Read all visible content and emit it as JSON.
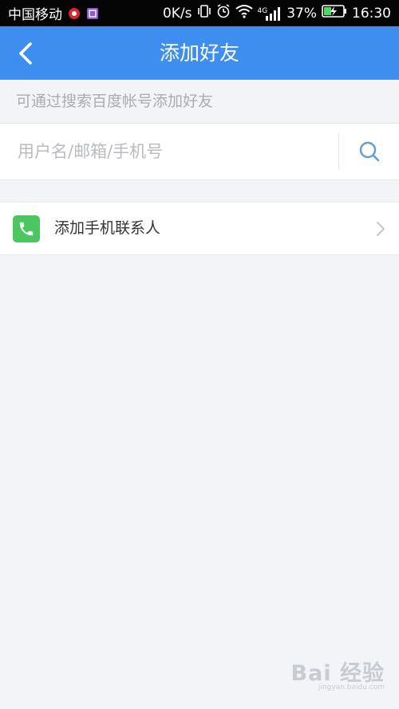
{
  "status_bar": {
    "carrier": "中国移动",
    "speed": "0K/s",
    "network": "4G",
    "battery": "37%",
    "time": "16:30"
  },
  "header": {
    "title": "添加好友"
  },
  "hint": "可通过搜索百度帐号添加好友",
  "search": {
    "placeholder": "用户名/邮箱/手机号",
    "value": ""
  },
  "contacts_row": {
    "label": "添加手机联系人"
  },
  "watermark": {
    "logo": "Bai 经验",
    "url": "jingyan.baidu.com"
  },
  "colors": {
    "header_bg": "#3d8eef",
    "phone_icon_bg": "#4cc760",
    "page_bg": "#f2f4f7"
  },
  "icons": [
    "back-arrow-icon",
    "search-icon",
    "phone-icon",
    "chevron-right-icon",
    "wifi-icon",
    "signal-icon",
    "battery-icon",
    "alarm-icon",
    "vibrate-icon"
  ]
}
